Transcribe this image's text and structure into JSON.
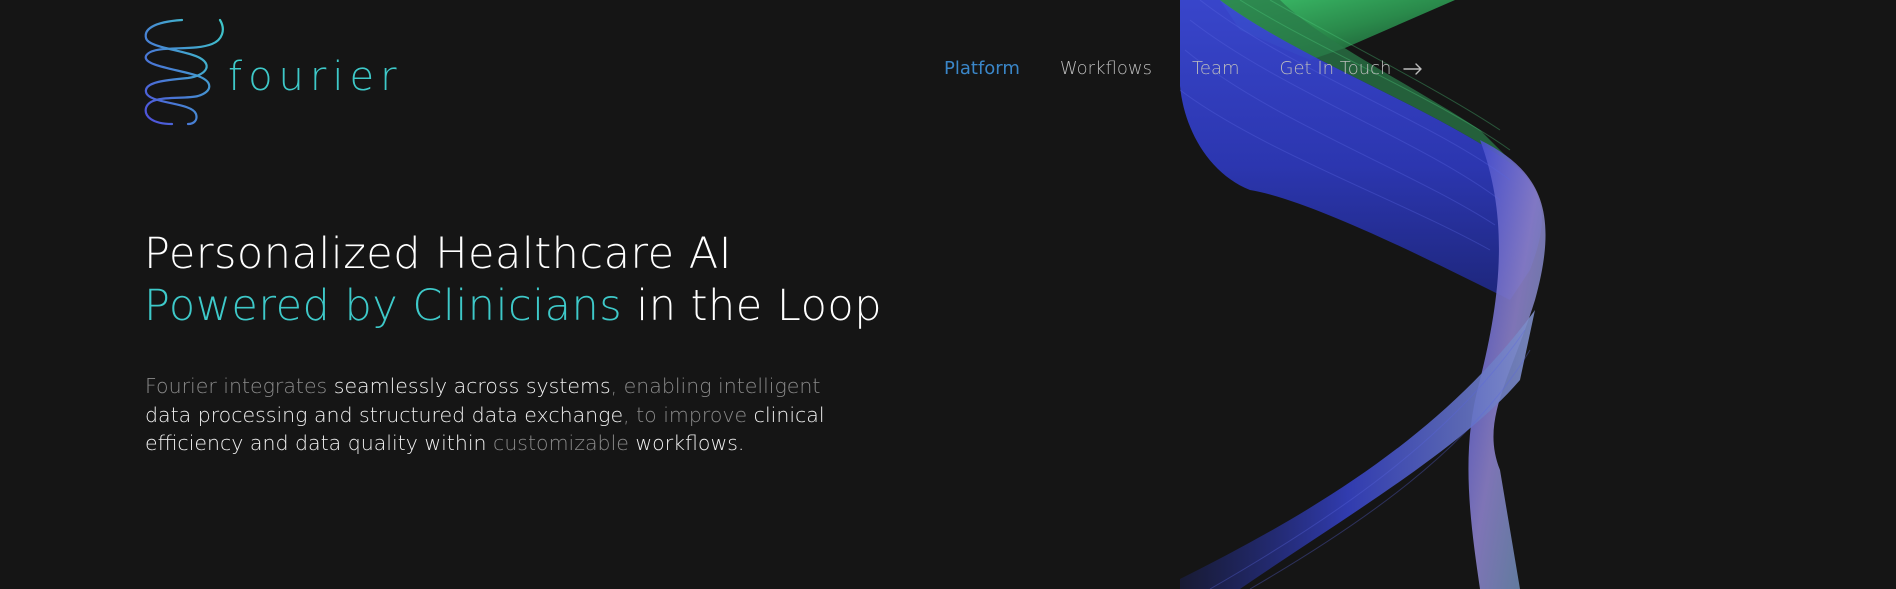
{
  "brand": {
    "name": "fourier",
    "logo_icon": "double-helix-icon",
    "accent_color": "#3ec9c9",
    "logo_gradient": [
      "#4f4fdc",
      "#3ec9c9"
    ]
  },
  "nav": {
    "items": [
      {
        "label": "Platform",
        "active": true
      },
      {
        "label": "Workflows",
        "active": false
      },
      {
        "label": "Team",
        "active": false
      }
    ],
    "cta": {
      "label": "Get In Touch",
      "icon": "arrow-right-icon"
    },
    "active_color": "#3a86c8",
    "text_color": "#bdbdbd"
  },
  "hero": {
    "title_line1": "Personalized Healthcare AI",
    "title_line2_accent": "Powered by Clinicians",
    "title_line2_rest": " in the Loop",
    "body": [
      {
        "text": "Fourier integrates ",
        "highlight": false
      },
      {
        "text": "seamlessly across systems",
        "highlight": true
      },
      {
        "text": ", enabling intelligent ",
        "highlight": false
      },
      {
        "text": "data processing and structured data exchange",
        "highlight": true
      },
      {
        "text": ", to improve ",
        "highlight": false
      },
      {
        "text": "clinical efficiency and data quality within",
        "highlight": true
      },
      {
        "text": " customizable ",
        "highlight": false
      },
      {
        "text": "workflows.",
        "highlight": true
      }
    ]
  },
  "background": {
    "color": "#151515",
    "art": "helix-ribbon-illustration",
    "ribbon_colors": [
      "#2f9a55",
      "#3340c4",
      "#8a7fc8"
    ]
  }
}
